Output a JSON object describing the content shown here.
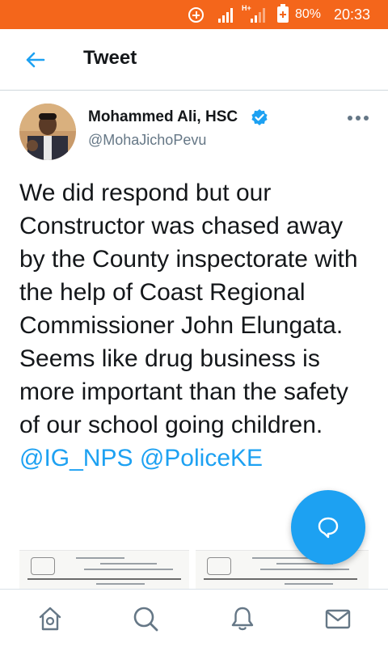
{
  "status_bar": {
    "network_type": "H+",
    "battery_percent": "80%",
    "time": "20:33"
  },
  "header": {
    "title": "Tweet"
  },
  "tweet": {
    "author_name": "Mohammed Ali, HSC",
    "author_handle": "@MohaJichoPevu",
    "text": "We did respond but our Constructor was chased away by the County inspectorate with the help of Coast Regional Commissioner John Elungata. Seems like drug business is more important than the safety of our school going children.",
    "mentions": [
      "@IG_NPS",
      "@PoliceKE"
    ]
  },
  "icons": {
    "back": "arrow-left-icon",
    "more": "more-dots-icon",
    "verified": "verified-badge-icon",
    "fab": "reply-bubble-icon",
    "nav": [
      "home-icon",
      "search-icon",
      "bell-icon",
      "mail-icon"
    ]
  },
  "colors": {
    "status_bar": "#f4661b",
    "accent": "#1da1f2",
    "text": "#14171a",
    "secondary_text": "#657786"
  }
}
